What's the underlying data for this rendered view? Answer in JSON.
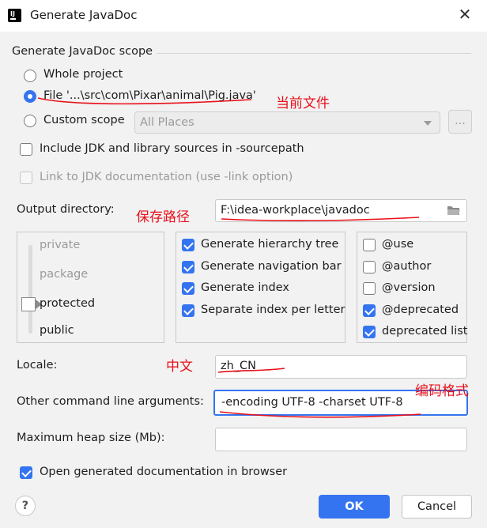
{
  "window": {
    "title": "Generate JavaDoc",
    "close_icon": "close-icon"
  },
  "scope": {
    "section_title": "Generate JavaDoc scope",
    "whole_project": "Whole project",
    "file": "File '...\\src\\com\\Pixar\\animal\\Pig.java'",
    "custom_scope": "Custom scope",
    "custom_scope_combo": "All Places",
    "browse_label": "...",
    "selected": "file"
  },
  "include_jdk": {
    "label": "Include JDK and library sources in -sourcepath",
    "checked": false
  },
  "link_jdk": {
    "label": "Link to JDK documentation (use -link option)",
    "checked": false,
    "disabled": true
  },
  "output": {
    "label": "Output directory:",
    "value": "F:\\idea-workplace\\javadoc"
  },
  "visibility": {
    "levels": [
      "private",
      "package",
      "protected",
      "public"
    ],
    "selected": "protected"
  },
  "generate_options": [
    {
      "label": "Generate hierarchy tree",
      "checked": true
    },
    {
      "label": "Generate navigation bar",
      "checked": true
    },
    {
      "label": "Generate index",
      "checked": true
    },
    {
      "label": "Separate index per letter",
      "checked": true
    }
  ],
  "tag_options": [
    {
      "label": "@use",
      "checked": false
    },
    {
      "label": "@author",
      "checked": false
    },
    {
      "label": "@version",
      "checked": false
    },
    {
      "label": "@deprecated",
      "checked": true
    },
    {
      "label": "deprecated list",
      "checked": true
    }
  ],
  "locale": {
    "label": "Locale:",
    "value": "zh_CN"
  },
  "other_args": {
    "label": "Other command line arguments:",
    "value": "-encoding UTF-8 -charset UTF-8"
  },
  "heap": {
    "label": "Maximum heap size (Mb):",
    "value": ""
  },
  "open_browser": {
    "label": "Open generated documentation in browser",
    "checked": true
  },
  "buttons": {
    "help": "?",
    "ok": "OK",
    "cancel": "Cancel"
  },
  "annotations": {
    "current_file": "当前文件",
    "save_path": "保存路径",
    "chinese": "中文",
    "encoding": "编码格式"
  },
  "colors": {
    "accent": "#3574f0",
    "annotation": "#e8101a"
  }
}
